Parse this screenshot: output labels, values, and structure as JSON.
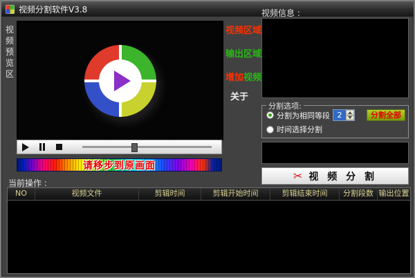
{
  "window": {
    "title": "视频分割软件V3.8"
  },
  "colors": {
    "menu_red": "#ff2f00",
    "menu_green": "#28b614",
    "selection_blue": "#316ac5",
    "watermark_red": "#e60000",
    "split_all_green": "#7a9a08",
    "table_header_text": "#d8cf92"
  },
  "preview": {
    "side_label": "视频预览区"
  },
  "player": {
    "watermark": "请移步到原画面"
  },
  "menu": {
    "video_area": {
      "label": "视频区域",
      "style": "color:#ff2f00"
    },
    "output_area": {
      "label": "输出区域",
      "style": "color:#28b614"
    },
    "add_video_part1": {
      "text": "增加",
      "style": "color:#ff2f00"
    },
    "add_video_part2": {
      "text": "视频",
      "style": "color:#28b614"
    },
    "about": {
      "label": "关于",
      "style": "color:#f0f0f0"
    }
  },
  "info": {
    "label": "视频信息 :"
  },
  "split_options": {
    "title": "分割选项:",
    "option_equal": "分割为相同等段",
    "segments_value": "2",
    "split_all_label": "分割全部",
    "option_time": "时间选择分割"
  },
  "actions": {
    "scissors_icon": "✂",
    "split_button_label": "视 频 分 割"
  },
  "current_op": {
    "label": "当前操作 :"
  },
  "table": {
    "headers": [
      "NO",
      "视频文件",
      "剪辑时间",
      "剪辑开始时间",
      "剪辑结束时间",
      "分割段数",
      "输出位置"
    ],
    "rows": []
  }
}
